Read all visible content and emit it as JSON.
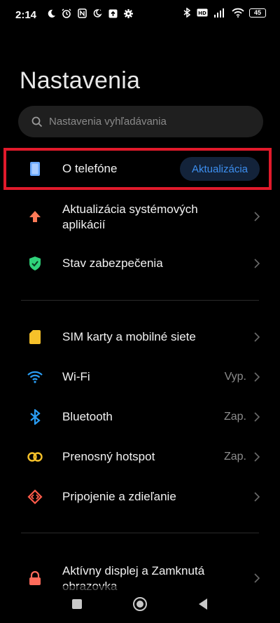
{
  "status": {
    "time": "2:14",
    "battery": "45",
    "left_icons": [
      "moon-icon",
      "alarm-icon",
      "nfc-icon",
      "night-icon",
      "upload-icon",
      "gear-icon"
    ],
    "right_icons": [
      "bluetooth-icon",
      "volte-icon",
      "signal-icon",
      "wifi-icon",
      "battery-icon"
    ]
  },
  "header": {
    "title": "Nastavenia"
  },
  "search": {
    "placeholder": "Nastavenia vyhľadávania"
  },
  "items": [
    {
      "label": "O telefóne",
      "badge": "Aktualizácia",
      "icon": "phone-icon",
      "color": "#6aa9ff"
    },
    {
      "label": "Aktualizácia systémových aplikácií",
      "label_line1": "Aktualizácia systémových",
      "label_line2": "aplikácií",
      "icon": "arrow-up-icon",
      "color": "#ff7a57"
    },
    {
      "label": "Stav zabezpečenia",
      "icon": "shield-check-icon",
      "color": "#2fd27a"
    },
    {
      "label": "SIM karty a mobilné siete",
      "icon": "sim-card-icon",
      "color": "#f6c12a"
    },
    {
      "label": "Wi-Fi",
      "value": "Vyp.",
      "icon": "wifi-icon",
      "color": "#2a9df4"
    },
    {
      "label": "Bluetooth",
      "value": "Zap.",
      "icon": "bluetooth-icon",
      "color": "#2a9df4"
    },
    {
      "label": "Prenosný hotspot",
      "value": "Zap.",
      "icon": "hotspot-icon",
      "color": "#f6c12a"
    },
    {
      "label": "Pripojenie a zdieľanie",
      "icon": "connection-share-icon",
      "color": "#ff5b4a"
    },
    {
      "label": "Aktívny displej a Zamknutá obrazovka",
      "label_line1": "Aktívny displej a Zamknutá",
      "label_line2": "obrazovka",
      "icon": "lock-icon",
      "color": "#ff6b5b"
    }
  ],
  "colors": {
    "highlight": "#e11a2b",
    "accent": "#3d8ff0",
    "background": "#000000"
  },
  "nav": {
    "buttons": [
      "recents-button",
      "home-button",
      "back-button"
    ]
  }
}
